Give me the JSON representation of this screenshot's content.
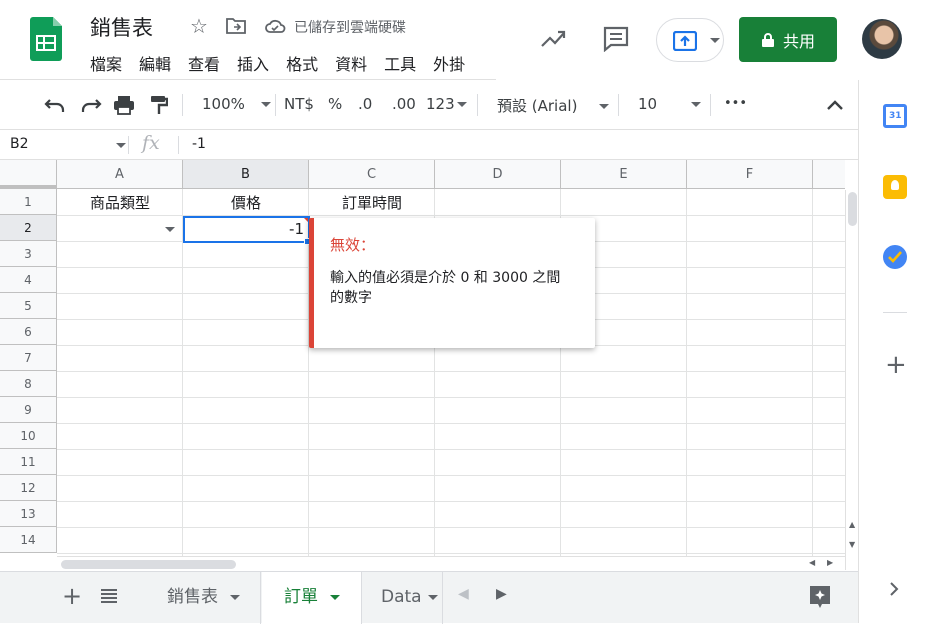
{
  "header": {
    "doc_title": "銷售表",
    "save_status": "已儲存到雲端硬碟",
    "menu": [
      "檔案",
      "編輯",
      "查看",
      "插入",
      "格式",
      "資料",
      "工具",
      "外掛"
    ],
    "share_label": "共用"
  },
  "toolbar": {
    "zoom": "100%",
    "currency": "NT$",
    "percent": "%",
    "dec_less": ".0",
    "dec_more": ".00",
    "number_format": "123",
    "font": "預設 (Arial)",
    "font_size": "10",
    "more": "•••"
  },
  "formula_bar": {
    "cell_ref": "B2",
    "fx": "fx",
    "value": "-1"
  },
  "grid": {
    "columns": [
      "A",
      "B",
      "C",
      "D",
      "E",
      "F"
    ],
    "rows": [
      "1",
      "2",
      "3",
      "4",
      "5",
      "6",
      "7",
      "8",
      "9",
      "10",
      "11",
      "12",
      "13",
      "14"
    ],
    "cells": {
      "A1": "商品類型",
      "B1": "價格",
      "C1": "訂單時間",
      "B2": "-1"
    }
  },
  "validation_tooltip": {
    "title": "無效：",
    "message": "輸入的值必須是介於 0 和 3000 之間的數字"
  },
  "sheet_tabs": [
    {
      "label": "銷售表",
      "active": false
    },
    {
      "label": "訂單",
      "active": true
    },
    {
      "label": "Data",
      "active": false
    }
  ],
  "colors": {
    "brand_green": "#188038",
    "selection_blue": "#1a73e8",
    "error_red": "#db4437"
  }
}
